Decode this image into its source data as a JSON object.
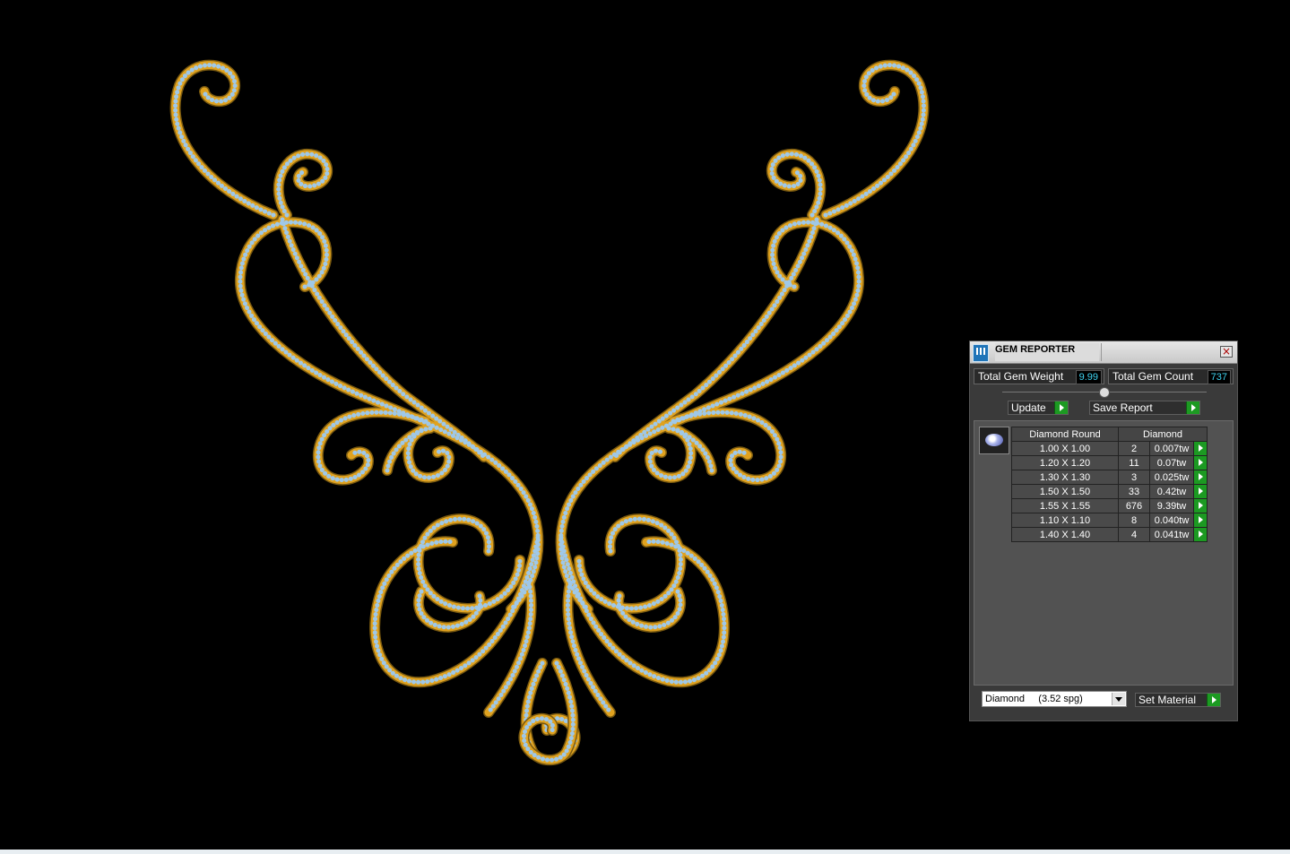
{
  "viewport": {
    "metal_color": "#e0a21f",
    "gem_color": "#9fc8e8",
    "background": "#000000"
  },
  "gem_reporter": {
    "title": "GEM REPORTER",
    "total_gem_weight_label": "Total Gem Weight",
    "total_gem_weight_value": "9.99",
    "total_gem_count_label": "Total Gem Count",
    "total_gem_count_value": "737",
    "update_label": "Update",
    "save_report_label": "Save Report",
    "table": {
      "headers": [
        "Diamond Round",
        "Diamond"
      ],
      "rows": [
        {
          "size": "1.00 X 1.00",
          "count": "2",
          "weight": "0.007tw"
        },
        {
          "size": "1.20 X 1.20",
          "count": "11",
          "weight": "0.07tw"
        },
        {
          "size": "1.30 X 1.30",
          "count": "3",
          "weight": "0.025tw"
        },
        {
          "size": "1.50 X 1.50",
          "count": "33",
          "weight": "0.42tw"
        },
        {
          "size": "1.55 X 1.55",
          "count": "676",
          "weight": "9.39tw"
        },
        {
          "size": "1.10 X 1.10",
          "count": "8",
          "weight": "0.040tw"
        },
        {
          "size": "1.40 X 1.40",
          "count": "4",
          "weight": "0.041tw"
        }
      ]
    },
    "material_select": {
      "value": "Diamond     (3.52 spg)"
    },
    "set_material_label": "Set Material",
    "close_icon": "close-icon",
    "accent_green": "#1c9a22",
    "value_color": "#3fd3f0"
  }
}
